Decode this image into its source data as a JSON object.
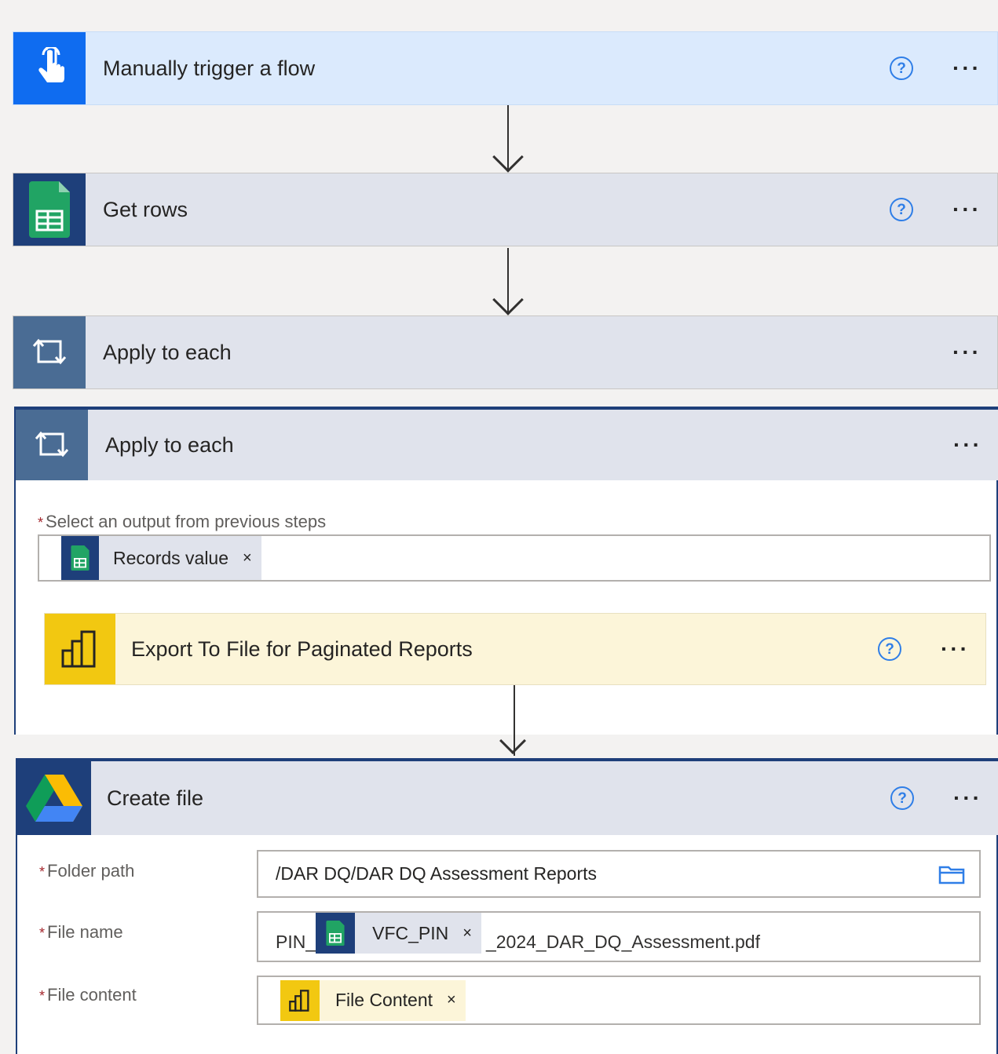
{
  "steps": [
    {
      "title": "Manually trigger a flow",
      "icon": "hand-pointer-icon"
    },
    {
      "title": "Get rows",
      "icon": "google-sheets-icon"
    },
    {
      "title": "Apply to each",
      "icon": "loop-icon"
    }
  ],
  "apply_each": {
    "title": "Apply to each",
    "select_label": "Select an output from previous steps",
    "token": "Records value",
    "export_step": "Export To File for Paginated Reports"
  },
  "create_file": {
    "title": "Create file",
    "folder_label": "Folder path",
    "folder_value": "/DAR DQ/DAR DQ Assessment Reports",
    "file_name_label": "File name",
    "file_name_prefix": "PIN_",
    "file_name_token": "VFC_PIN",
    "file_name_suffix": "_2024_DAR_DQ_Assessment.pdf",
    "file_content_label": "File content",
    "file_content_token": "File Content"
  },
  "common": {
    "more": "···",
    "help": "?",
    "required": "*",
    "remove": "×"
  },
  "colors": {
    "trigger_header": "#dbeafd",
    "trigger_icon": "#0f6cf0",
    "sheets_icon": "#1e3f7a",
    "loop_icon": "#4a6c94",
    "header_gray": "#e0e3ec",
    "powerbi_yellow": "#f2c811",
    "export_bg": "#fcf5d9",
    "drive_icon": "#1e3f7a"
  }
}
